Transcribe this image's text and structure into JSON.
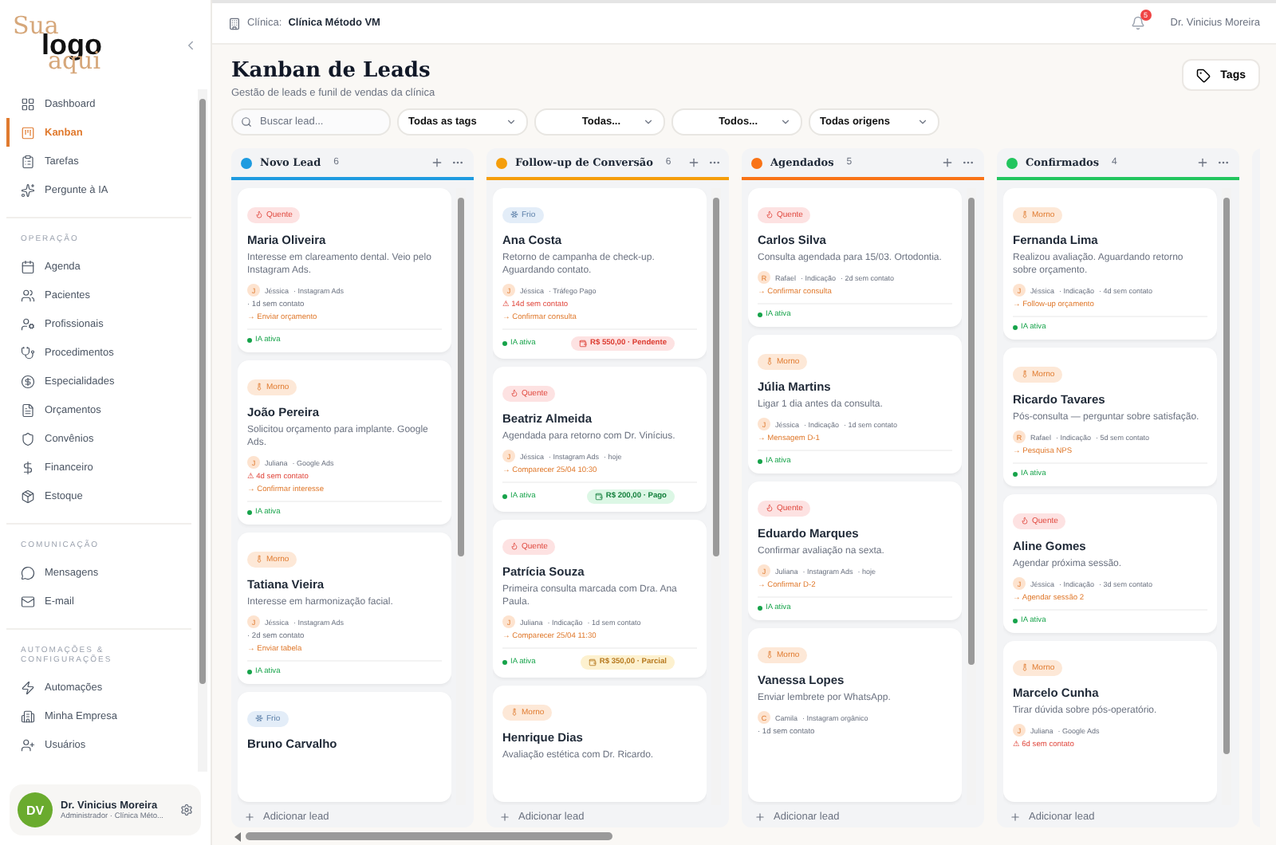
{
  "sidebar": {
    "logo": [
      "Sua",
      "logo",
      "aqui"
    ],
    "nav": [
      {
        "label": "Dashboard",
        "selected": false
      },
      {
        "label": "Kanban",
        "selected": true
      },
      {
        "label": "Tarefas",
        "selected": false
      },
      {
        "label": "Pergunte à IA",
        "selected": false
      }
    ],
    "sections": [
      {
        "title": "OPERAÇÃO",
        "items": [
          {
            "label": "Agenda",
            "selected": false
          },
          {
            "label": "Pacientes",
            "selected": false
          },
          {
            "label": "Profissionais",
            "selected": false
          },
          {
            "label": "Procedimentos",
            "selected": false
          },
          {
            "label": "Especialidades",
            "selected": false
          },
          {
            "label": "Orçamentos",
            "selected": false
          },
          {
            "label": "Convênios",
            "selected": false
          },
          {
            "label": "Financeiro",
            "selected": false
          },
          {
            "label": "Estoque",
            "selected": false
          }
        ]
      },
      {
        "title": "COMUNICAÇÃO",
        "items": [
          {
            "label": "Mensagens",
            "selected": false
          },
          {
            "label": "E-mail",
            "selected": false
          }
        ]
      },
      {
        "title": "AUTOMAÇÕES & CONFIGURAÇÕES",
        "items": [
          {
            "label": "Automações",
            "selected": false
          },
          {
            "label": "Minha Empresa",
            "selected": false
          },
          {
            "label": "Usuários",
            "selected": false
          }
        ]
      }
    ],
    "user": {
      "initials": "DV",
      "name": "Dr. Vinicius Moreira",
      "role": "Administrador · Clínica Méto..."
    }
  },
  "header": {
    "clinic_label": "Clínica:",
    "clinic": "Clínica Método VM",
    "notifications": "5",
    "user": "Dr. Vinicius Moreira"
  },
  "page": {
    "title": "Kanban de Leads",
    "subtitle": "Gestão de leads e funil de vendas da clínica",
    "tags_button": "Tags"
  },
  "filters": {
    "search": {
      "placeholder": "Buscar lead..."
    },
    "selects": [
      "Todas as tags",
      "Todas...",
      "Todos...",
      "Todas origens"
    ]
  },
  "columns": [
    {
      "title": "Novo Lead",
      "count": "6",
      "color": "#1e9be0",
      "add_label": "Adicionar lead",
      "cards": [
        {
          "tag": {
            "label": "Quente",
            "kind": "hot"
          },
          "name": "Maria Oliveira",
          "description": "Interesse em clareamento dental. Veio pelo Instagram Ads.",
          "initial": "J",
          "assignee": "Jéssica",
          "meta": [
            "· Instagram Ads"
          ],
          "lines": [
            {
              "kind": "contact",
              "text": "· 1d sem contato"
            },
            {
              "kind": "action",
              "text": "→ Enviar orçamento"
            }
          ],
          "ia": "IA ativa"
        },
        {
          "tag": {
            "label": "Morno",
            "kind": "warm"
          },
          "name": "João Pereira",
          "description": "Solicitou orçamento para implante. Google Ads.",
          "initial": "J",
          "assignee": "Juliana",
          "meta": [
            "· Google Ads"
          ],
          "lines": [
            {
              "kind": "alert",
              "text": "⚠ 4d sem contato"
            },
            {
              "kind": "action",
              "text": "→ Confirmar interesse"
            }
          ],
          "ia": "IA ativa"
        },
        {
          "tag": {
            "label": "Morno",
            "kind": "warm"
          },
          "name": "Tatiana Vieira",
          "description": "Interesse em harmonização facial.",
          "initial": "J",
          "assignee": "Jéssica",
          "meta": [
            "· Instagram Ads"
          ],
          "lines": [
            {
              "kind": "contact",
              "text": "· 2d sem contato"
            },
            {
              "kind": "action",
              "text": "→ Enviar tabela"
            }
          ],
          "ia": "IA ativa"
        },
        {
          "tag": {
            "label": "Frio",
            "kind": "cold"
          },
          "name": "Bruno Carvalho"
        }
      ]
    },
    {
      "title": "Follow-up de Conversão",
      "count": "6",
      "color": "#f59e0b",
      "add_label": "Adicionar lead",
      "cards": [
        {
          "tag": {
            "label": "Frio",
            "kind": "cold"
          },
          "name": "Ana Costa",
          "description": "Retorno de campanha de check-up. Aguardando contato.",
          "initial": "J",
          "assignee": "Jéssica",
          "meta": [
            "· Tráfego Pago"
          ],
          "lines": [
            {
              "kind": "alert",
              "text": "⚠ 14d sem contato"
            },
            {
              "kind": "action",
              "text": "→ Confirmar consulta"
            }
          ],
          "ia": "IA ativa",
          "payment": {
            "text": "R$ 550,00 · Pendente",
            "kind": "pending"
          }
        },
        {
          "tag": {
            "label": "Quente",
            "kind": "hot"
          },
          "name": "Beatriz Almeida",
          "description": "Agendada para retorno com Dr. Vinícius.",
          "initial": "J",
          "assignee": "Jéssica",
          "meta": [
            "· Instagram Ads",
            "· hoje"
          ],
          "lines": [
            {
              "kind": "action",
              "text": "→ Comparecer 25/04 10:30"
            }
          ],
          "ia": "IA ativa",
          "payment": {
            "text": "R$ 200,00 · Pago",
            "kind": "paid"
          }
        },
        {
          "tag": {
            "label": "Quente",
            "kind": "hot"
          },
          "name": "Patrícia Souza",
          "description": "Primeira consulta marcada com Dra. Ana Paula.",
          "initial": "J",
          "assignee": "Juliana",
          "meta": [
            "· Indicação",
            "· 1d sem contato"
          ],
          "lines": [
            {
              "kind": "action",
              "text": "→ Comparecer 25/04 11:30"
            }
          ],
          "ia": "IA ativa",
          "payment": {
            "text": "R$ 350,00 · Parcial",
            "kind": "partial"
          }
        },
        {
          "tag": {
            "label": "Morno",
            "kind": "warm"
          },
          "name": "Henrique Dias",
          "description": "Avaliação estética com Dr. Ricardo."
        }
      ]
    },
    {
      "title": "Agendados",
      "count": "5",
      "color": "#f97316",
      "add_label": "Adicionar lead",
      "cards": [
        {
          "tag": {
            "label": "Quente",
            "kind": "hot"
          },
          "name": "Carlos Silva",
          "description": "Consulta agendada para 15/03. Ortodontia.",
          "initial": "R",
          "assignee": "Rafael",
          "meta": [
            "· Indicação",
            "· 2d sem contato"
          ],
          "lines": [
            {
              "kind": "action",
              "text": "→ Confirmar consulta"
            }
          ],
          "ia": "IA ativa"
        },
        {
          "tag": {
            "label": "Morno",
            "kind": "warm"
          },
          "name": "Júlia Martins",
          "description": "Ligar 1 dia antes da consulta.",
          "initial": "J",
          "assignee": "Jéssica",
          "meta": [
            "· Indicação",
            "· 1d sem contato"
          ],
          "lines": [
            {
              "kind": "action",
              "text": "→ Mensagem D-1"
            }
          ],
          "ia": "IA ativa"
        },
        {
          "tag": {
            "label": "Quente",
            "kind": "hot"
          },
          "name": "Eduardo Marques",
          "description": "Confirmar avaliação na sexta.",
          "initial": "J",
          "assignee": "Juliana",
          "meta": [
            "· Instagram Ads",
            "· hoje"
          ],
          "lines": [
            {
              "kind": "action",
              "text": "→ Confirmar D-2"
            }
          ],
          "ia": "IA ativa"
        },
        {
          "tag": {
            "label": "Morno",
            "kind": "warm"
          },
          "name": "Vanessa Lopes",
          "description": "Enviar lembrete por WhatsApp.",
          "initial": "C",
          "assignee": "Camila",
          "meta": [
            "· Instagram orgânico"
          ],
          "lines": [
            {
              "kind": "contact",
              "text": "· 1d sem contato"
            }
          ]
        }
      ]
    },
    {
      "title": "Confirmados",
      "count": "4",
      "color": "#22c55e",
      "add_label": "Adicionar lead",
      "cards": [
        {
          "tag": {
            "label": "Morno",
            "kind": "warm"
          },
          "name": "Fernanda Lima",
          "description": "Realizou avaliação. Aguardando retorno sobre orçamento.",
          "initial": "J",
          "assignee": "Jéssica",
          "meta": [
            "· Indicação",
            "· 4d sem contato"
          ],
          "lines": [
            {
              "kind": "action",
              "text": "→ Follow-up orçamento"
            }
          ],
          "ia": "IA ativa"
        },
        {
          "tag": {
            "label": "Morno",
            "kind": "warm"
          },
          "name": "Ricardo Tavares",
          "description": "Pós-consulta — perguntar sobre satisfação.",
          "initial": "R",
          "assignee": "Rafael",
          "meta": [
            "· Indicação",
            "· 5d sem contato"
          ],
          "lines": [
            {
              "kind": "action",
              "text": "→ Pesquisa NPS"
            }
          ],
          "ia": "IA ativa"
        },
        {
          "tag": {
            "label": "Quente",
            "kind": "hot"
          },
          "name": "Aline Gomes",
          "description": "Agendar próxima sessão.",
          "initial": "J",
          "assignee": "Jéssica",
          "meta": [
            "· Indicação",
            "· 3d sem contato"
          ],
          "lines": [
            {
              "kind": "action",
              "text": "→ Agendar sessão 2"
            }
          ],
          "ia": "IA ativa"
        },
        {
          "tag": {
            "label": "Morno",
            "kind": "warm"
          },
          "name": "Marcelo Cunha",
          "description": "Tirar dúvida sobre pós-operatório.",
          "initial": "J",
          "assignee": "Juliana",
          "meta": [
            "· Google Ads"
          ],
          "lines": [
            {
              "kind": "alert",
              "text": "⚠ 6d sem contato"
            }
          ]
        }
      ]
    }
  ]
}
